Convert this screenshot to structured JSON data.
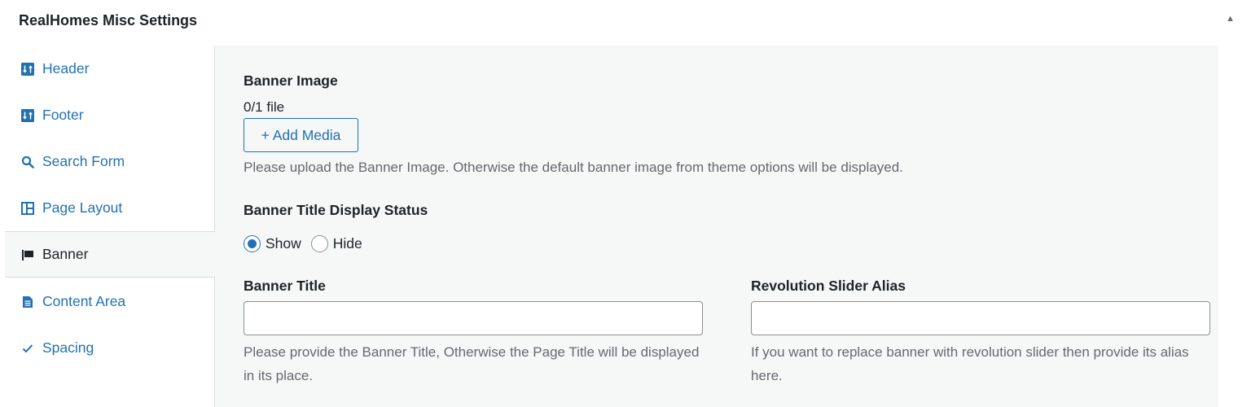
{
  "panel": {
    "title": "RealHomes Misc Settings",
    "toggle_icon": "triangle-up",
    "toggle_glyph": "▲"
  },
  "tabs": [
    {
      "label": "Header",
      "icon": "sort-arrows-icon",
      "active": false
    },
    {
      "label": "Footer",
      "icon": "sort-arrows-icon",
      "active": false
    },
    {
      "label": "Search Form",
      "icon": "search-icon",
      "active": false
    },
    {
      "label": "Page Layout",
      "icon": "layout-grid-icon",
      "active": false
    },
    {
      "label": "Banner",
      "icon": "flag-icon",
      "active": true
    },
    {
      "label": "Content Area",
      "icon": "page-icon",
      "active": false
    },
    {
      "label": "Spacing",
      "icon": "checkmark-icon",
      "active": false
    }
  ],
  "banner_image": {
    "label": "Banner Image",
    "file_count": "0/1 file",
    "add_button": "+ Add Media",
    "description": "Please upload the Banner Image. Otherwise the default banner image from theme options will be displayed."
  },
  "title_display": {
    "label": "Banner Title Display Status",
    "options": [
      {
        "label": "Show",
        "checked": true
      },
      {
        "label": "Hide",
        "checked": false
      }
    ]
  },
  "banner_title": {
    "label": "Banner Title",
    "value": "",
    "description": "Please provide the Banner Title, Otherwise the Page Title will be displayed in its place."
  },
  "slider_alias": {
    "label": "Revolution Slider Alias",
    "value": "",
    "description": "If you want to replace banner with revolution slider then provide its alias here."
  },
  "colors": {
    "accent": "#2271b1",
    "text": "#1d2327",
    "muted": "#646970",
    "content_bg": "#f6f7f7"
  }
}
